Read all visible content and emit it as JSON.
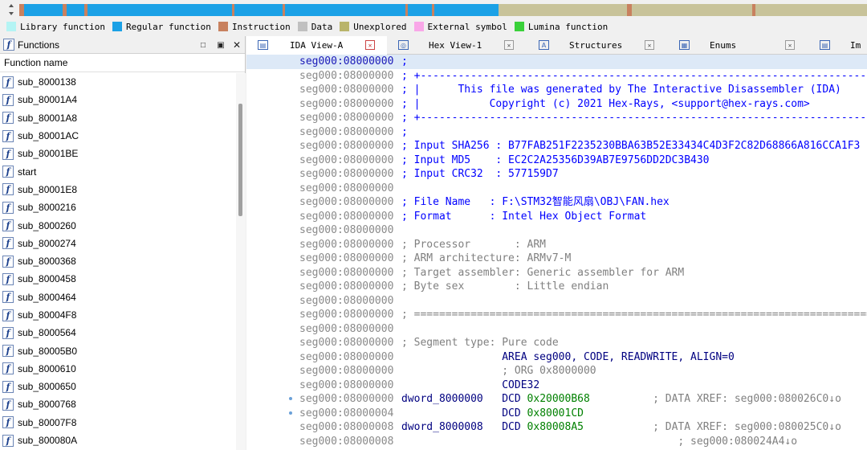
{
  "nav_band": {
    "segments": [
      {
        "color": "#c8815f",
        "w": 6
      },
      {
        "color": "#1ba1e6",
        "w": 48
      },
      {
        "color": "#c8815f",
        "w": 5
      },
      {
        "color": "#1ba1e6",
        "w": 22
      },
      {
        "color": "#c8815f",
        "w": 4
      },
      {
        "color": "#1ba1e6",
        "w": 180
      },
      {
        "color": "#c8815f",
        "w": 3
      },
      {
        "color": "#1ba1e6",
        "w": 60
      },
      {
        "color": "#c8815f",
        "w": 3
      },
      {
        "color": "#1ba1e6",
        "w": 150
      },
      {
        "color": "#c8815f",
        "w": 3
      },
      {
        "color": "#1ba1e6",
        "w": 30
      },
      {
        "color": "#c8815f",
        "w": 3
      },
      {
        "color": "#1ba1e6",
        "w": 80
      },
      {
        "color": "#c8c39a",
        "w": 160
      },
      {
        "color": "#c8815f",
        "w": 6
      },
      {
        "color": "#c8c39a",
        "w": 150
      },
      {
        "color": "#c8815f",
        "w": 4
      },
      {
        "color": "#c8c39a",
        "w": 139
      }
    ]
  },
  "legend": [
    {
      "label": "Library function",
      "color": "#b4f4f4"
    },
    {
      "label": "Regular function",
      "color": "#1ba1e6"
    },
    {
      "label": "Instruction",
      "color": "#c8815f"
    },
    {
      "label": "Data",
      "color": "#c0c0c0"
    },
    {
      "label": "Unexplored",
      "color": "#b9b46a"
    },
    {
      "label": "External symbol",
      "color": "#f9a7e8"
    },
    {
      "label": "Lumina function",
      "color": "#3ad13a"
    }
  ],
  "functions_panel": {
    "title": "Functions",
    "icon": "f-function-icon",
    "buttons": [
      "□",
      "▣",
      "✕"
    ],
    "column_header": "Function name",
    "items": [
      "sub_8000138",
      "sub_80001A4",
      "sub_80001A8",
      "sub_80001AC",
      "sub_80001BE",
      "start",
      "sub_80001E8",
      "sub_8000216",
      "sub_8000260",
      "sub_8000274",
      "sub_8000368",
      "sub_8000458",
      "sub_8000464",
      "sub_80004F8",
      "sub_8000564",
      "sub_80005B0",
      "sub_8000610",
      "sub_8000650",
      "sub_8000768",
      "sub_80007F8",
      "sub_800080A"
    ]
  },
  "tabs": [
    {
      "label": "IDA View-A",
      "icon": "ida-view-icon",
      "icon_char": "▤",
      "active": true
    },
    {
      "label": "Hex View-1",
      "icon": "hex-view-icon",
      "icon_char": "◎",
      "active": false
    },
    {
      "label": "Structures",
      "icon": "structures-icon",
      "icon_char": "A",
      "active": false
    },
    {
      "label": "Enums",
      "icon": "enums-icon",
      "icon_char": "▦",
      "active": false
    },
    {
      "label": "Im",
      "icon": "imports-icon",
      "icon_char": "▤",
      "active": false
    }
  ],
  "close_glyph": "✕",
  "listing": [
    {
      "addr": "seg000:08000000",
      "parts": [
        [
          "x-blue",
          ";"
        ]
      ],
      "cur": true
    },
    {
      "addr": "seg000:08000000",
      "parts": [
        [
          "x-blue",
          "; +-------------------------------------------------------------------------"
        ]
      ]
    },
    {
      "addr": "seg000:08000000",
      "parts": [
        [
          "x-blue",
          "; |      This file was generated by The Interactive Disassembler (IDA)"
        ]
      ]
    },
    {
      "addr": "seg000:08000000",
      "parts": [
        [
          "x-blue",
          "; |           Copyright (c) 2021 Hex-Rays, <support@hex-rays.com>"
        ]
      ]
    },
    {
      "addr": "seg000:08000000",
      "parts": [
        [
          "x-blue",
          "; +-------------------------------------------------------------------------"
        ]
      ]
    },
    {
      "addr": "seg000:08000000",
      "parts": [
        [
          "x-blue",
          ";"
        ]
      ]
    },
    {
      "addr": "seg000:08000000",
      "parts": [
        [
          "x-blue",
          "; Input SHA256 : B77FAB251F2235230BBA63B52E33434C4D3F2C82D68866A816CCA1F3"
        ]
      ]
    },
    {
      "addr": "seg000:08000000",
      "parts": [
        [
          "x-blue",
          "; Input MD5    : EC2C2A25356D39AB7E9756DD2DC3B430"
        ]
      ]
    },
    {
      "addr": "seg000:08000000",
      "parts": [
        [
          "x-blue",
          "; Input CRC32  : 577159D7"
        ]
      ]
    },
    {
      "addr": "seg000:08000000",
      "parts": []
    },
    {
      "addr": "seg000:08000000",
      "parts": [
        [
          "x-blue",
          "; File Name   : F:\\STM32智能风扇\\OBJ\\FAN.hex"
        ]
      ]
    },
    {
      "addr": "seg000:08000000",
      "parts": [
        [
          "x-blue",
          "; Format      : Intel Hex Object Format"
        ]
      ]
    },
    {
      "addr": "seg000:08000000",
      "parts": []
    },
    {
      "addr": "seg000:08000000",
      "parts": [
        [
          "x-gray",
          "; Processor       : ARM"
        ]
      ]
    },
    {
      "addr": "seg000:08000000",
      "parts": [
        [
          "x-gray",
          "; ARM architecture: ARMv7-M"
        ]
      ]
    },
    {
      "addr": "seg000:08000000",
      "parts": [
        [
          "x-gray",
          "; Target assembler: Generic assembler for ARM"
        ]
      ]
    },
    {
      "addr": "seg000:08000000",
      "parts": [
        [
          "x-gray",
          "; Byte sex        : Little endian"
        ]
      ]
    },
    {
      "addr": "seg000:08000000",
      "parts": []
    },
    {
      "addr": "seg000:08000000",
      "parts": [
        [
          "x-gray",
          "; ========================================================================="
        ]
      ]
    },
    {
      "addr": "seg000:08000000",
      "parts": []
    },
    {
      "addr": "seg000:08000000",
      "parts": [
        [
          "x-gray",
          "; Segment type: Pure code"
        ]
      ]
    },
    {
      "addr": "seg000:08000000",
      "parts": [
        [
          "x-kw",
          "                AREA seg000, CODE, READWRITE, ALIGN=0"
        ]
      ]
    },
    {
      "addr": "seg000:08000000",
      "parts": [
        [
          "x-gray",
          "                ; ORG 0x8000000"
        ]
      ]
    },
    {
      "addr": "seg000:08000000",
      "parts": [
        [
          "x-kw",
          "                CODE32"
        ]
      ]
    },
    {
      "addr": "seg000:08000000",
      "dot": true,
      "parts": [
        [
          "x-lbl",
          "dword_8000000"
        ],
        [
          "x-kw",
          "   DCD "
        ],
        [
          "x-num",
          "0x20000B68"
        ],
        [
          "x-cmt",
          "          ; DATA XREF: seg000:080026C0↓o"
        ]
      ]
    },
    {
      "addr": "seg000:08000004",
      "dot": true,
      "parts": [
        [
          "x-kw",
          "                DCD "
        ],
        [
          "x-num",
          "0x80001CD"
        ]
      ]
    },
    {
      "addr": "seg000:08000008",
      "parts": [
        [
          "x-lbl",
          "dword_8000008"
        ],
        [
          "x-kw",
          "   DCD "
        ],
        [
          "x-num",
          "0x80008A5"
        ],
        [
          "x-cmt",
          "           ; DATA XREF: seg000:080025C0↓o"
        ]
      ]
    },
    {
      "addr": "seg000:08000008",
      "parts": [
        [
          "x-cmt",
          "                                            ; seg000:080024A4↓o"
        ]
      ]
    }
  ]
}
